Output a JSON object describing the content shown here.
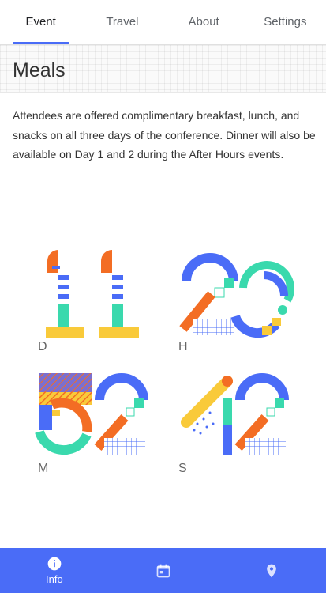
{
  "tabs": [
    {
      "label": "Event",
      "active": true
    },
    {
      "label": "Travel",
      "active": false
    },
    {
      "label": "About",
      "active": false
    },
    {
      "label": "Settings",
      "active": false
    }
  ],
  "page": {
    "title": "Meals",
    "description": "Attendees are offered complimentary breakfast, lunch, and snacks on all three days of the conference. Dinner will also be available on Day 1 and 2 during the After Hours events."
  },
  "countdown": {
    "days": {
      "value": "11",
      "unit": "D"
    },
    "hours": {
      "value": "23",
      "unit": "H"
    },
    "minutes": {
      "value": "52",
      "unit": "M"
    },
    "seconds": {
      "value": "42",
      "unit": "S"
    }
  },
  "bottom_nav": [
    {
      "label": "Info",
      "icon": "info-icon",
      "active": true
    },
    {
      "label": "",
      "icon": "calendar-icon",
      "active": false
    },
    {
      "label": "",
      "icon": "location-pin-icon",
      "active": false
    }
  ],
  "colors": {
    "accent": "#4a6cf7",
    "orange": "#f36d24",
    "teal": "#3ad9ad",
    "yellow": "#f9ca3a",
    "blue": "#4a6cf7"
  }
}
